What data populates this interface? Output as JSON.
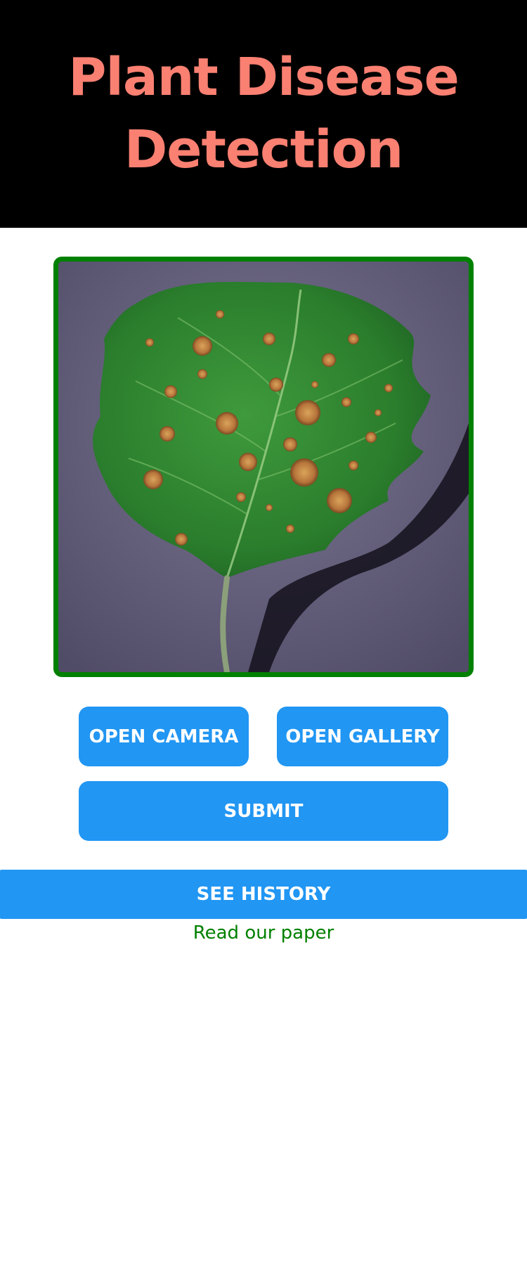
{
  "header": {
    "title": "Plant Disease Detection",
    "background_color": "#000000",
    "title_color": "#fa8072"
  },
  "preview": {
    "content": "green leaf with brown spots on dark purple background",
    "border_color": "#008000"
  },
  "actions": {
    "open_camera_label": "OPEN CAMERA",
    "open_gallery_label": "OPEN GALLERY",
    "submit_label": "SUBMIT",
    "see_history_label": "SEE HISTORY",
    "button_color": "#2196f3"
  },
  "footer": {
    "paper_link_label": "Read our paper",
    "link_color": "#008000"
  }
}
